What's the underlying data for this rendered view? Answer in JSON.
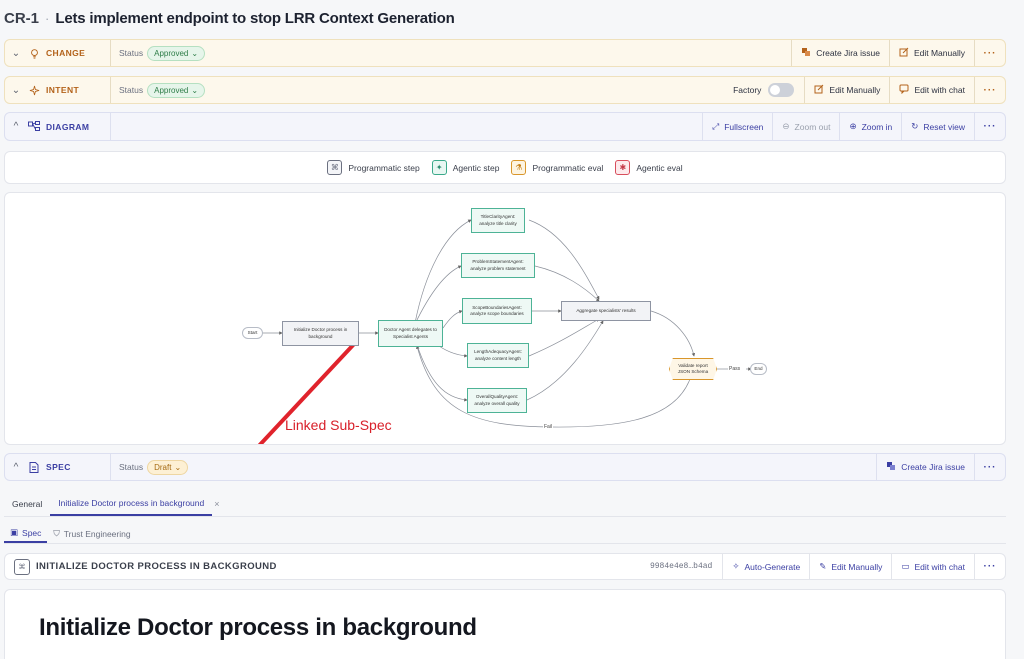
{
  "header": {
    "id": "CR-1",
    "separator": "·",
    "title": "Lets implement endpoint to stop LRR Context Generation"
  },
  "change": {
    "label": "CHANGE",
    "status_label": "Status",
    "status": "Approved",
    "actions": {
      "jira": "Create Jira issue",
      "edit": "Edit Manually",
      "more": "···"
    }
  },
  "intent": {
    "label": "INTENT",
    "status_label": "Status",
    "status": "Approved",
    "factory_label": "Factory",
    "factory_on": false,
    "actions": {
      "edit": "Edit Manually",
      "chat": "Edit with chat",
      "more": "···"
    }
  },
  "diagram_bar": {
    "label": "DIAGRAM",
    "actions": {
      "fullscreen": "Fullscreen",
      "zoom_out": "Zoom out",
      "zoom_in": "Zoom in",
      "reset": "Reset view",
      "more": "···"
    }
  },
  "legend": [
    {
      "label": "Programmatic step"
    },
    {
      "label": "Agentic step"
    },
    {
      "label": "Programmatic eval"
    },
    {
      "label": "Agentic eval"
    }
  ],
  "diagram": {
    "start": "Start",
    "init": "Initialize Doctor process in background",
    "doctor": "Doctor Agent delegates to Specialist Agents",
    "agents": [
      "TitleClarityAgent: analyze title clarity",
      "ProblemStatementAgent: analyze problem statement",
      "ScopeBoundariesAgent: analyze scope boundaries",
      "LengthAdequacyAgent: analyze content length",
      "OverallQualityAgent: analyze overall quality"
    ],
    "aggregate": "Aggregate specialists' results",
    "validate": "Validate report JSON Schema",
    "pass": "Pass",
    "end": "End",
    "fail": "Fail"
  },
  "annotation": "Linked Sub-Spec",
  "spec_bar": {
    "label": "SPEC",
    "status_label": "Status",
    "status": "Draft",
    "actions": {
      "jira": "Create Jira issue",
      "more": "···"
    }
  },
  "tabs": {
    "general": "General",
    "active": "Initialize Doctor process in background",
    "close": "×"
  },
  "subtabs": {
    "spec": "Spec",
    "trust": "Trust Engineering"
  },
  "spec_header": {
    "title": "INITIALIZE DOCTOR PROCESS IN BACKGROUND",
    "hash": "9984e4e8…b4ad",
    "auto": "Auto-Generate",
    "edit": "Edit Manually",
    "chat": "Edit with chat",
    "more": "···"
  },
  "doc": {
    "heading": "Initialize Doctor process in background"
  }
}
